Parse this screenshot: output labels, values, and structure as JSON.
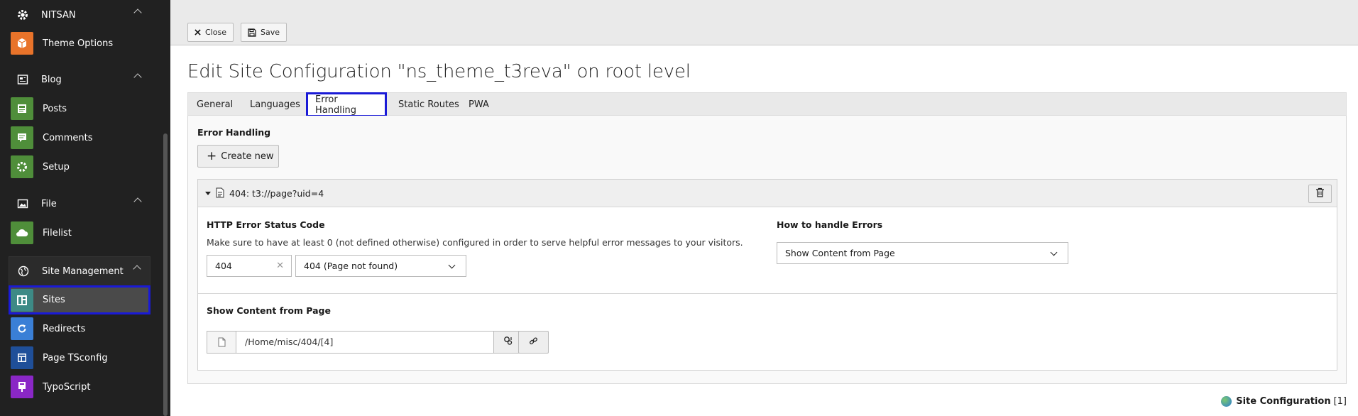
{
  "sidebar": {
    "groups": {
      "nitsan": "NITSAN",
      "blog": "Blog",
      "file": "File",
      "site_management": "Site Management"
    },
    "items": {
      "theme_options": "Theme Options",
      "posts": "Posts",
      "comments": "Comments",
      "setup": "Setup",
      "filelist": "Filelist",
      "sites": "Sites",
      "redirects": "Redirects",
      "page_tsconfig": "Page TSconfig",
      "typoscript": "TypoScript"
    },
    "colors": {
      "theme_options": "#e8732a",
      "blog_green": "#4f8e3a",
      "sites": "#3d8a86",
      "redirects": "#3a7fd6",
      "page_tsconfig": "#1f4f99",
      "typoscript": "#8a27c6"
    }
  },
  "toolbar": {
    "close_label": "Close",
    "save_label": "Save"
  },
  "page": {
    "title": "Edit Site Configuration \"ns_theme_t3reva\" on root level"
  },
  "tabs": {
    "general": "General",
    "languages": "Languages",
    "error_handling": "Error Handling",
    "static_routes": "Static Routes",
    "pwa": "PWA",
    "active": "Error Handling"
  },
  "error_handling": {
    "heading": "Error Handling",
    "create_new_label": "Create new",
    "record": {
      "label": "404: t3://page?uid=4",
      "status_code": {
        "title": "HTTP Error Status Code",
        "description": "Make sure to have at least 0 (not defined otherwise) configured in order to serve helpful error messages to your visitors.",
        "value": "404",
        "selected_option": "404 (Page not found)"
      },
      "handling": {
        "title": "How to handle Errors",
        "selected_option": "Show Content from Page"
      },
      "show_content": {
        "title": "Show Content from Page",
        "value": "/Home/misc/404/[4]"
      }
    }
  },
  "footer": {
    "label": "Site Configuration",
    "count": "[1]"
  }
}
